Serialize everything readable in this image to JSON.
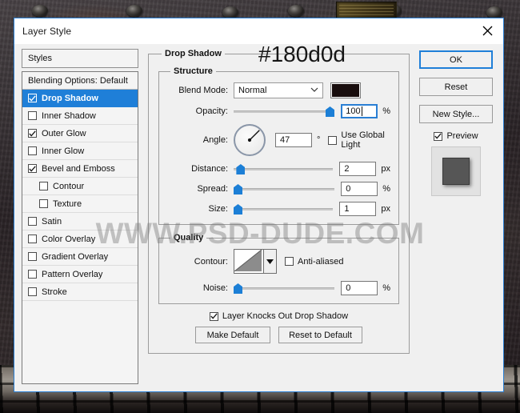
{
  "window": {
    "title": "Layer Style",
    "close_icon": "close-icon"
  },
  "annotation": {
    "hex_callout": "#180d0d"
  },
  "watermark": {
    "text": "WWW.PSD-DUDE.COM"
  },
  "styles_panel": {
    "header": "Styles",
    "items": [
      {
        "label": "Blending Options: Default",
        "checkbox": false,
        "has_checkbox": false,
        "indent": false,
        "selected": false
      },
      {
        "label": "Drop Shadow",
        "checkbox": true,
        "has_checkbox": true,
        "indent": false,
        "selected": true
      },
      {
        "label": "Inner Shadow",
        "checkbox": false,
        "has_checkbox": true,
        "indent": false,
        "selected": false
      },
      {
        "label": "Outer Glow",
        "checkbox": true,
        "has_checkbox": true,
        "indent": false,
        "selected": false
      },
      {
        "label": "Inner Glow",
        "checkbox": false,
        "has_checkbox": true,
        "indent": false,
        "selected": false
      },
      {
        "label": "Bevel and Emboss",
        "checkbox": true,
        "has_checkbox": true,
        "indent": false,
        "selected": false
      },
      {
        "label": "Contour",
        "checkbox": false,
        "has_checkbox": true,
        "indent": true,
        "selected": false
      },
      {
        "label": "Texture",
        "checkbox": false,
        "has_checkbox": true,
        "indent": true,
        "selected": false
      },
      {
        "label": "Satin",
        "checkbox": false,
        "has_checkbox": true,
        "indent": false,
        "selected": false
      },
      {
        "label": "Color Overlay",
        "checkbox": false,
        "has_checkbox": true,
        "indent": false,
        "selected": false
      },
      {
        "label": "Gradient Overlay",
        "checkbox": false,
        "has_checkbox": true,
        "indent": false,
        "selected": false
      },
      {
        "label": "Pattern Overlay",
        "checkbox": false,
        "has_checkbox": true,
        "indent": false,
        "selected": false
      },
      {
        "label": "Stroke",
        "checkbox": false,
        "has_checkbox": true,
        "indent": false,
        "selected": false
      }
    ]
  },
  "drop_shadow": {
    "group_title": "Drop Shadow",
    "structure": {
      "title": "Structure",
      "blend_mode_label": "Blend Mode:",
      "blend_mode_value": "Normal",
      "shadow_color": "#180d0d",
      "opacity_label": "Opacity:",
      "opacity_value": "100",
      "opacity_unit": "%",
      "opacity_percent": 100,
      "angle_label": "Angle:",
      "angle_value": "47",
      "angle_unit": "°",
      "use_global_light_label": "Use Global Light",
      "use_global_light_checked": false,
      "distance_label": "Distance:",
      "distance_value": "2",
      "distance_unit": "px",
      "distance_percent": 3,
      "spread_label": "Spread:",
      "spread_value": "0",
      "spread_unit": "%",
      "spread_percent": 0,
      "size_label": "Size:",
      "size_value": "1",
      "size_unit": "px",
      "size_percent": 0
    },
    "quality": {
      "title": "Quality",
      "contour_label": "Contour:",
      "anti_aliased_label": "Anti-aliased",
      "anti_aliased_checked": false,
      "noise_label": "Noise:",
      "noise_value": "0",
      "noise_unit": "%",
      "noise_percent": 0
    },
    "footer": {
      "knocks_out_label": "Layer Knocks Out Drop Shadow",
      "knocks_out_checked": true,
      "make_default": "Make Default",
      "reset_to_default": "Reset to Default"
    }
  },
  "actions": {
    "ok": "OK",
    "reset": "Reset",
    "new_style": "New Style...",
    "preview_label": "Preview",
    "preview_checked": true
  },
  "colors": {
    "accent": "#1f7fd8",
    "dialog_bg": "#f0f0f0",
    "shadow_swatch": "#180d0d",
    "slider_thumb": "#1c7fd6"
  }
}
